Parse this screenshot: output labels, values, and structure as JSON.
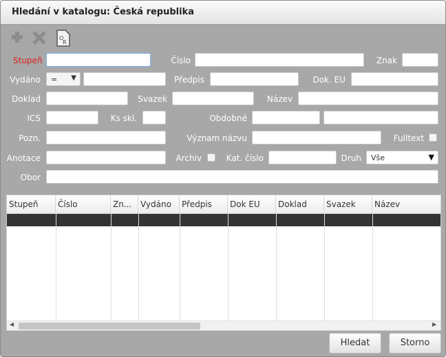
{
  "title": "Hledání v katalogu: Česká republika",
  "toolbar": {
    "icons": [
      "add-icon",
      "delete-icon",
      "report-icon"
    ]
  },
  "labels": {
    "stupen": "Stupeň",
    "cislo": "Číslo",
    "znak": "Znak",
    "vydano": "Vydáno",
    "predpis": "Předpis",
    "dok_eu": "Dok. EU",
    "doklad": "Doklad",
    "svazek": "Svazek",
    "nazev": "Název",
    "ics": "ICS",
    "ks_skl": "Ks skl.",
    "obdobne": "Obdobné",
    "pozn": "Pozn.",
    "vyznam_nazvu": "Význam názvu",
    "fulltext": "Fulltext",
    "anotace": "Anotace",
    "archiv": "Archiv",
    "kat_cislo": "Kat. číslo",
    "druh": "Druh",
    "obor": "Obor"
  },
  "vydano_operator": "=",
  "druh_value": "Vše",
  "columns": [
    "Stupeň",
    "Číslo",
    "Zn...",
    "Vydáno",
    "Předpis",
    "Dok EU",
    "Doklad",
    "Svazek",
    "Název"
  ],
  "buttons": {
    "search": "Hledat",
    "cancel": "Storno"
  },
  "colors": {
    "required_label": "#e02020",
    "selected_row": "#333333",
    "dialog_bg": "#a8a8a8"
  }
}
